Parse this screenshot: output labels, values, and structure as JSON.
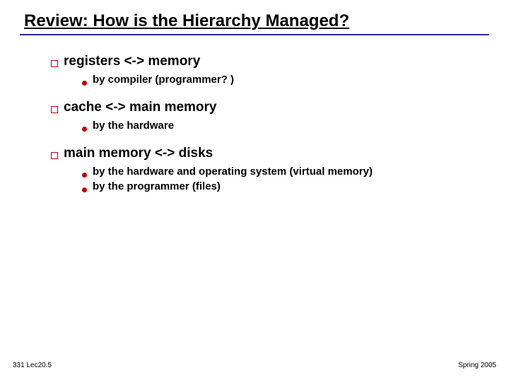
{
  "title": "Review:  How is the Hierarchy Managed?",
  "items": [
    {
      "label": "registers <-> memory",
      "sub": [
        "by compiler (programmer? )"
      ]
    },
    {
      "label": "cache <-> main memory",
      "sub": [
        "by the hardware"
      ]
    },
    {
      "label": "main memory <-> disks",
      "sub": [
        "by the hardware and operating system (virtual memory)",
        "by the programmer (files)"
      ]
    }
  ],
  "footer": {
    "left": "331 Lec20.5",
    "right": "Spring 2005"
  }
}
